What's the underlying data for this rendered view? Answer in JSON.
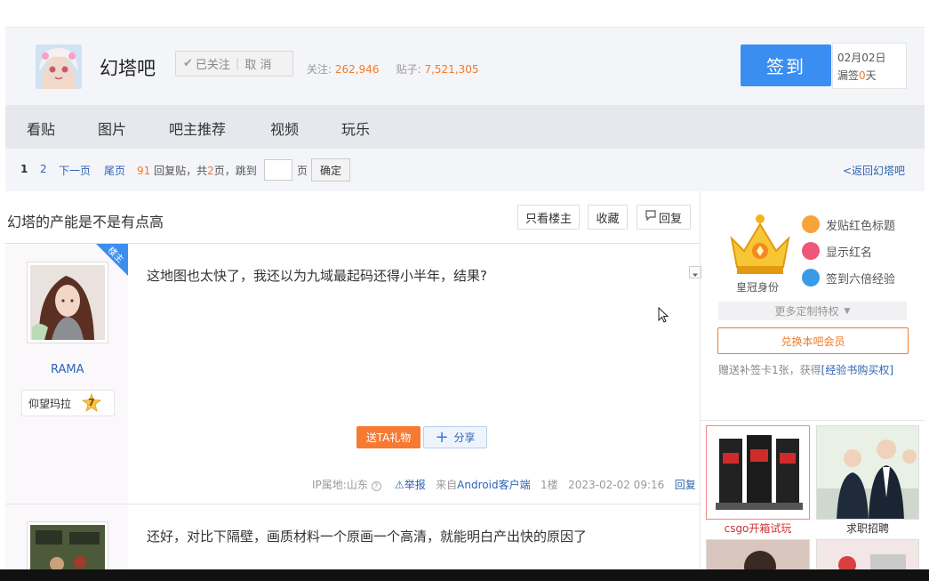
{
  "header": {
    "forum_name": "幻塔吧",
    "follow_state": "已关注",
    "unfollow": "取 消",
    "followers_label": "关注:",
    "followers": "262,946",
    "posts_label": "贴子:",
    "posts": "7,521,305",
    "checkin": "签到",
    "checkin_date": "02月02日",
    "checkin_streak_prefix": "漏签",
    "checkin_streak_value": "0",
    "checkin_streak_suffix": "天"
  },
  "nav": {
    "items": [
      "看贴",
      "图片",
      "吧主推荐",
      "视频",
      "玩乐"
    ]
  },
  "pager": {
    "current": "1",
    "page2": "2",
    "next": "下一页",
    "last": "尾页",
    "reply_count": "91",
    "reply_label": "回复贴，共",
    "total_pages": "2",
    "pages_label": "页，跳到",
    "page_unit": "页",
    "confirm": "确定",
    "back": "<返回幻塔吧"
  },
  "thread": {
    "title": "幻塔的产能是不是有点高",
    "only_op": "只看楼主",
    "favorite": "收藏",
    "reply": "回复"
  },
  "post1": {
    "louzhu_tag": "楼主",
    "username": "RAMA",
    "badge": "仰望玛拉",
    "level": "7",
    "content": "这地图也太快了，我还以为九域最起码还得小半年，结果?",
    "gift": "送TA礼物",
    "share": "分享",
    "ip": "IP属地:山东",
    "report": "举报",
    "source": "来自Android客户端",
    "floor": "1楼",
    "time": "2023-02-02 09:16",
    "reply": "回复"
  },
  "post2": {
    "content": "还好，对比下隔壁，画质材料一个原画一个高清，就能明白产出快的原因了"
  },
  "sidebar": {
    "crown_label": "皇冠身份",
    "perks": [
      "发贴红色标题",
      "显示红名",
      "签到六倍经验"
    ],
    "more_privileges": "更多定制特权",
    "redeem": "兑换本吧会员",
    "gift_note_prefix": "赠送补签卡1张，获得",
    "gift_note_link": "[经验书购买权]",
    "ads": [
      {
        "caption": "csgo开箱试玩"
      },
      {
        "caption": "求职招聘"
      }
    ]
  }
}
